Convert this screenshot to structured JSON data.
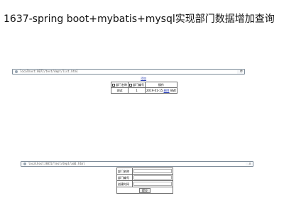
{
  "page_title": "1637-spring boot+mybatis+mysql实现部门数据增加查询",
  "browser1": {
    "url": "localhost:8072/test/dept/list.html",
    "icon": "reload-icon"
  },
  "list_page": {
    "add_link": "添加",
    "headers": [
      "部门名称",
      "部门编号",
      "操作"
    ],
    "rows": [
      {
        "name": "测试",
        "id": "1",
        "date": "2019-01-15",
        "actions": [
          "删除",
          "修改"
        ]
      }
    ]
  },
  "browser2": {
    "url": "localhost:8072/test/dept/add.html",
    "icon": "search-icon"
  },
  "form_page": {
    "fields": [
      {
        "label": "部门名称",
        "value": ""
      },
      {
        "label": "部门编号",
        "value": ""
      },
      {
        "label": "创建时间",
        "value": ""
      }
    ],
    "submit_label": "提交"
  }
}
